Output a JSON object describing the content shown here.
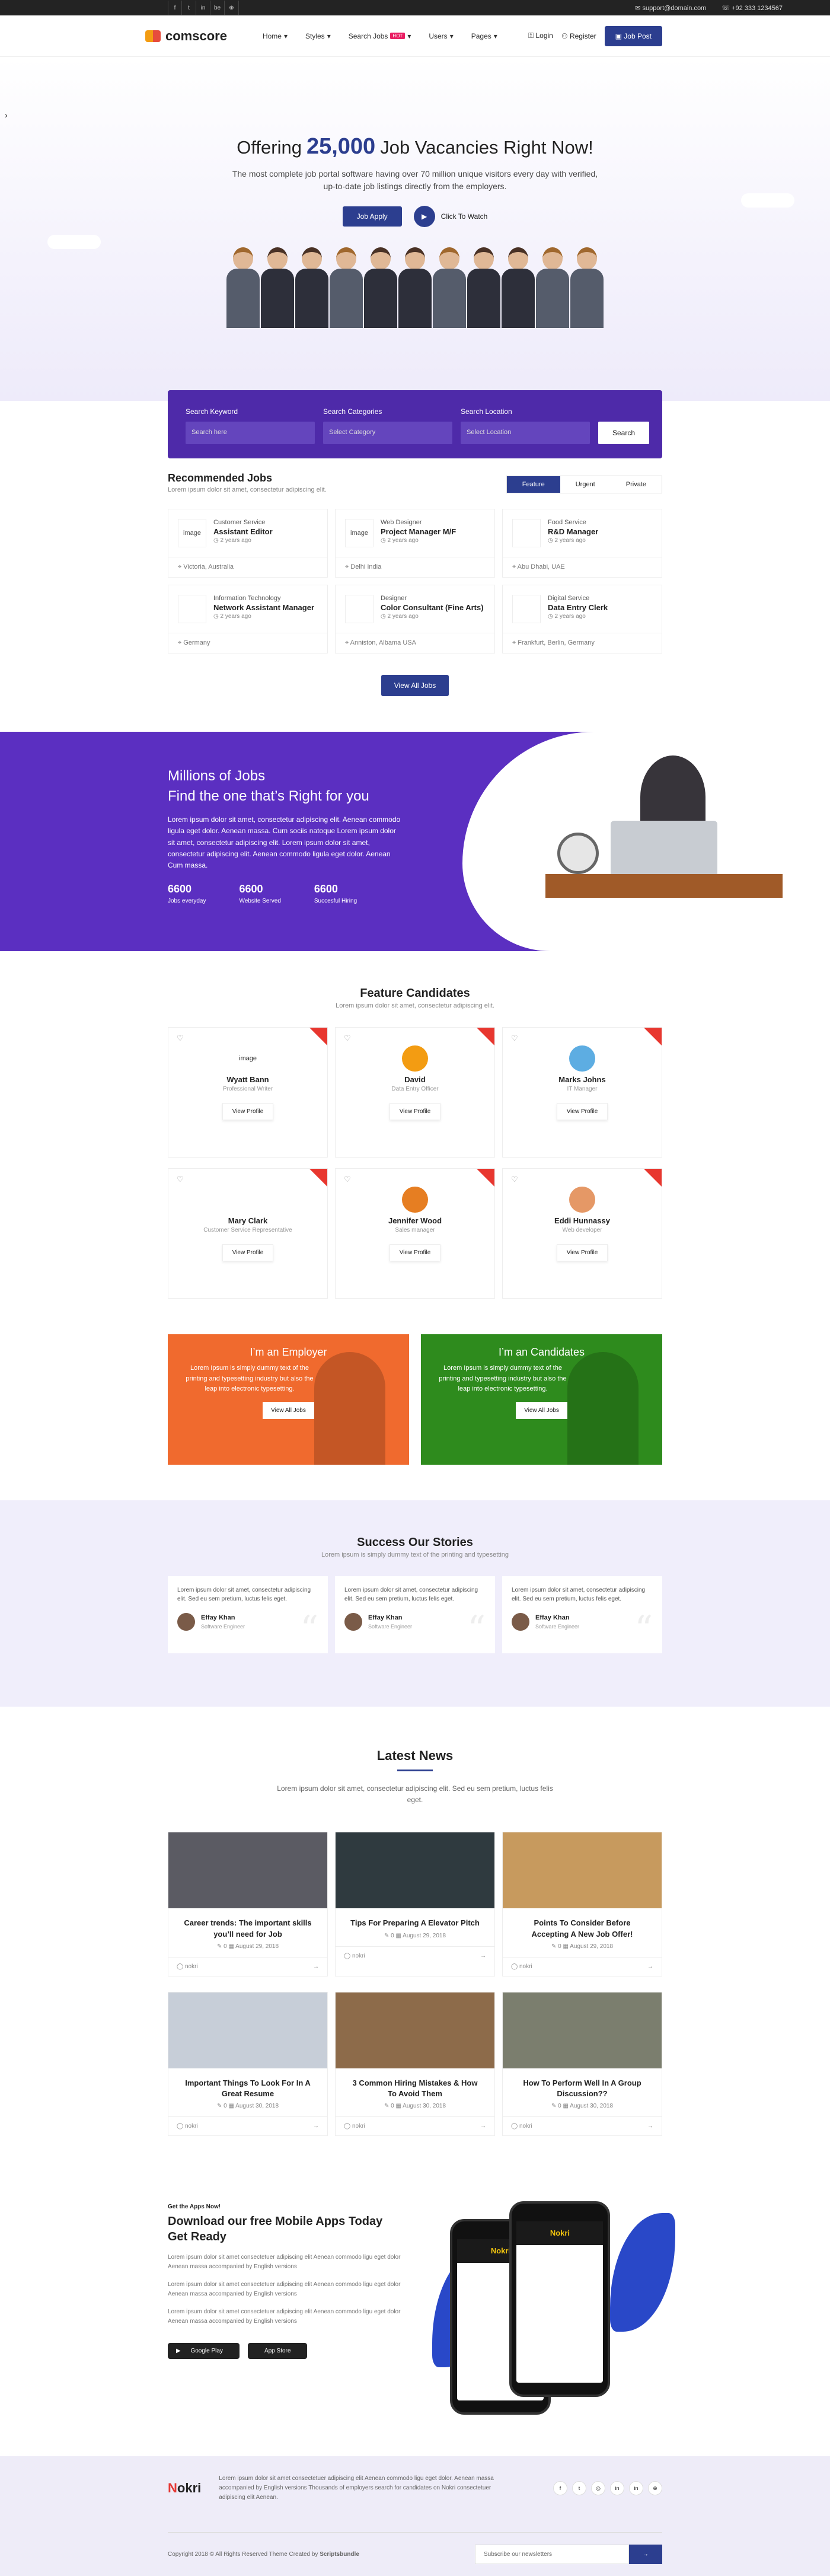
{
  "topbar": {
    "social": [
      "f",
      "t",
      "in",
      "be",
      "⊕"
    ],
    "email": "support@domain.com",
    "phone": "+92 333 1234567"
  },
  "nav": {
    "logo": "comscore",
    "menu": [
      "Home",
      "Styles",
      "Search Jobs",
      "Users",
      "Pages"
    ],
    "hot": "HOT",
    "login": "Login",
    "register": "Register",
    "post": "Job Post"
  },
  "hero": {
    "offering": "Offering",
    "number": "25,000",
    "rest": "Job Vacancies Right Now!",
    "desc": "The most complete job portal software having over 70 million unique visitors every day with verified, up-to-date job listings directly from the employers.",
    "apply": "Job Apply",
    "watch": "Click To Watch"
  },
  "search": {
    "kw_label": "Search Keyword",
    "kw_ph": "Search here",
    "cat_label": "Search Categories",
    "cat_ph": "Select Category",
    "loc_label": "Search Location",
    "loc_ph": "Select Location",
    "btn": "Search"
  },
  "recommended": {
    "title": "Recommended Jobs",
    "sub": "Lorem ipsum dolor sit amet, consectetur adipiscing elit.",
    "tabs": [
      "Feature",
      "Urgent",
      "Private"
    ],
    "jobs": [
      {
        "logo": "image",
        "cat": "Customer Service",
        "title": "Assistant Editor",
        "ago": "2 years ago",
        "loc": "Victoria, Australia"
      },
      {
        "logo": "image",
        "cat": "Web Designer",
        "title": "Project Manager M/F",
        "ago": "2 years ago",
        "loc": "Delhi India"
      },
      {
        "logo": "",
        "cat": "Food Service",
        "title": "R&D Manager",
        "ago": "2 years ago",
        "loc": "Abu Dhabi, UAE"
      },
      {
        "logo": "",
        "cat": "Information Technology",
        "title": "Network Assistant Manager",
        "ago": "2 years ago",
        "loc": "Germany"
      },
      {
        "logo": "",
        "cat": "Designer",
        "title": "Color Consultant (Fine Arts)",
        "ago": "2 years ago",
        "loc": "Anniston, Albama USA"
      },
      {
        "logo": "",
        "cat": "Digital Service",
        "title": "Data Entry Clerk",
        "ago": "2 years ago",
        "loc": "Frankfurt, Berlin, Germany"
      }
    ],
    "viewall": "View All Jobs"
  },
  "millions": {
    "line1": "Millions of Jobs",
    "line2": "Find the one that’s Right for you",
    "desc": "Lorem ipsum dolor sit amet, consectetur adipiscing elit. Aenean commodo ligula eget dolor. Aenean massa. Cum sociis natoque Lorem ipsum dolor sit amet, consectetur adipiscing elit. Lorem ipsum dolor sit amet, consectetur adipiscing elit. Aenean commodo ligula eget dolor. Aenean Cum massa.",
    "stats": [
      {
        "n": "6600",
        "l": "Jobs everyday"
      },
      {
        "n": "6600",
        "l": "Website Served"
      },
      {
        "n": "6600",
        "l": "Succesful Hiring"
      }
    ]
  },
  "candidates": {
    "title": "Feature Candidates",
    "sub": "Lorem ipsum dolor sit amet, consectetur adipiscing elit.",
    "btn": "View Profile",
    "list": [
      {
        "avatar": "image",
        "name": "Wyatt Bann",
        "role": "Professional Writer",
        "color": "#fff"
      },
      {
        "avatar": "",
        "name": "David",
        "role": "Data Entry Officer",
        "color": "#f39c12"
      },
      {
        "avatar": "",
        "name": "Marks Johns",
        "role": "IT Manager",
        "color": "#5dade2"
      },
      {
        "avatar": "",
        "name": "Mary Clark",
        "role": "Customer Service Representative",
        "color": "#ffffff"
      },
      {
        "avatar": "",
        "name": "Jennifer Wood",
        "role": "Sales manager",
        "color": "#e67e22"
      },
      {
        "avatar": "",
        "name": "Eddi Hunnassy",
        "role": "Web developer",
        "color": "#e59866"
      }
    ]
  },
  "promo": {
    "emp_title": "I’m an Employer",
    "emp_text": "Lorem Ipsum is simply dummy text of the printing and typesetting industry but also the leap into electronic typesetting.",
    "cand_title": "I’m an Candidates",
    "cand_text": "Lorem Ipsum is simply dummy text of the printing and typesetting industry but also the leap into electronic typesetting.",
    "btn": "View All Jobs"
  },
  "stories": {
    "title": "Success Our Stories",
    "sub": "Lorem ipsum is simply dummy text of the printing and typesetting",
    "text": "Lorem ipsum dolor sit amet, consectetur adipiscing elit. Sed eu sem pretium, luctus felis eget.",
    "name": "Effay Khan",
    "role": "Software Engineer"
  },
  "news": {
    "title": "Latest News",
    "lead": "Lorem ipsum dolor sit amet, consectetur adipiscing elit. Sed eu sem pretium, luctus felis eget.",
    "author": "nokri",
    "items": [
      {
        "t": "Career trends: The important skills you’ll need for Job",
        "c": "0",
        "d": "August 29, 2018",
        "img": "#5b5b63"
      },
      {
        "t": "Tips For Preparing A Elevator Pitch",
        "c": "0",
        "d": "August 29, 2018",
        "img": "#2f3a3f"
      },
      {
        "t": "Points To Consider Before Accepting A New Job Offer!",
        "c": "0",
        "d": "August 29, 2018",
        "img": "#c79a5e"
      },
      {
        "t": "Important Things To Look For In A Great Resume",
        "c": "0",
        "d": "August 30, 2018",
        "img": "#c7ced8"
      },
      {
        "t": "3 Common Hiring Mistakes & How To Avoid Them",
        "c": "0",
        "d": "August 30, 2018",
        "img": "#8d6b4a"
      },
      {
        "t": "How To Perform Well In A Group Discussion??",
        "c": "0",
        "d": "August 30, 2018",
        "img": "#7b7e6e"
      }
    ]
  },
  "apps": {
    "kicker": "Get the Apps Now!",
    "title": "Download our free Mobile Apps Today Get Ready",
    "p1": "Lorem ipsum dolor sit amet consectetuer adipiscing elit Aenean commodo ligu eget dolor Aenean massa accompanied by English versions",
    "p2": "Lorem ipsum dolor sit amet consectetuer adipiscing elit Aenean commodo ligu eget dolor Aenean massa accompanied by English versions",
    "p3": "Lorem ipsum dolor sit amet consectetuer adipiscing elit Aenean commodo ligu eget dolor Aenean massa accompanied by English versions",
    "gplay": "Google Play",
    "appstore": "App Store",
    "phone_logo": "Nokri"
  },
  "footer": {
    "logo_a": "N",
    "logo_o": "o",
    "logo_b": "kri",
    "text": "Lorem ipsum dolor sit amet consectetuer adipiscing elit Aenean commodo ligu eget dolor. Aenean massa accompanied by English versions Thousands of employers search for candidates on Nokri consectetuer adipiscing elit Aenean.",
    "social": [
      "f",
      "t",
      "◎",
      "in",
      "in",
      "⊕"
    ],
    "copy": "Copyright 2018 © All Rights Reserved Theme Created by ",
    "brand": "Scriptsbundle",
    "nl_ph": "Subscribe our newsletters",
    "nl_btn": "→"
  }
}
